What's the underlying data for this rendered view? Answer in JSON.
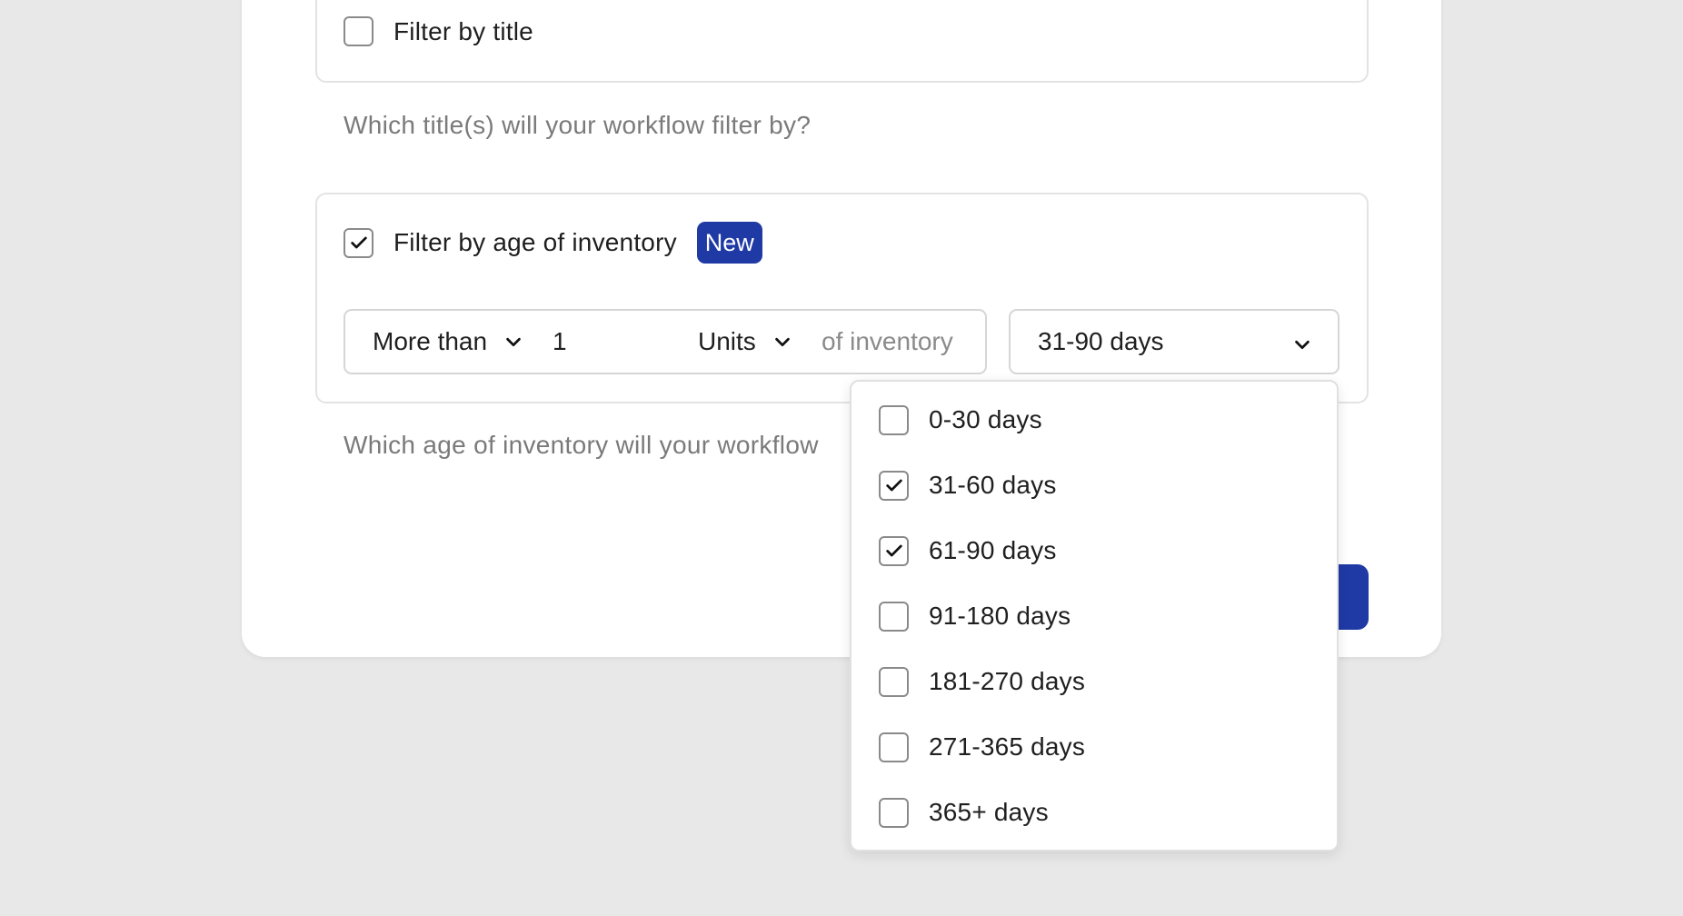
{
  "filters": {
    "title_filter": {
      "label": "Filter by title",
      "checked": false,
      "hint": "Which title(s) will your workflow filter by?"
    },
    "age_filter": {
      "label": "Filter by age of inventory",
      "checked": true,
      "badge": "New",
      "hint": "Which age of inventory will your workflow",
      "comparator": "More than",
      "quantity": "1",
      "unit": "Units",
      "suffix": "of inventory",
      "range_selected": "31-90 days",
      "range_options": [
        {
          "label": "0-30 days",
          "checked": false
        },
        {
          "label": "31-60 days",
          "checked": true
        },
        {
          "label": "61-90 days",
          "checked": true
        },
        {
          "label": "91-180 days",
          "checked": false
        },
        {
          "label": "181-270 days",
          "checked": false
        },
        {
          "label": "271-365 days",
          "checked": false
        },
        {
          "label": "365+ days",
          "checked": false
        }
      ]
    }
  },
  "colors": {
    "accent": "#1f3aa5",
    "background": "#e8e8e8",
    "border": "#d6d6d6",
    "hint_text": "#7a7a7a"
  },
  "icons": {
    "check": "checkmark-icon",
    "chevron": "chevron-down-icon"
  }
}
